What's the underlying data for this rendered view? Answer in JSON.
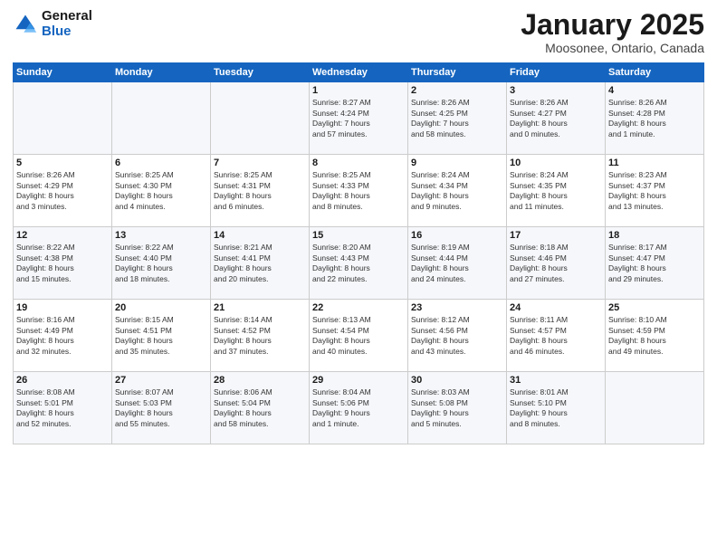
{
  "logo": {
    "line1": "General",
    "line2": "Blue"
  },
  "title": "January 2025",
  "location": "Moosonee, Ontario, Canada",
  "days_of_week": [
    "Sunday",
    "Monday",
    "Tuesday",
    "Wednesday",
    "Thursday",
    "Friday",
    "Saturday"
  ],
  "weeks": [
    [
      {
        "num": "",
        "info": ""
      },
      {
        "num": "",
        "info": ""
      },
      {
        "num": "",
        "info": ""
      },
      {
        "num": "1",
        "info": "Sunrise: 8:27 AM\nSunset: 4:24 PM\nDaylight: 7 hours\nand 57 minutes."
      },
      {
        "num": "2",
        "info": "Sunrise: 8:26 AM\nSunset: 4:25 PM\nDaylight: 7 hours\nand 58 minutes."
      },
      {
        "num": "3",
        "info": "Sunrise: 8:26 AM\nSunset: 4:27 PM\nDaylight: 8 hours\nand 0 minutes."
      },
      {
        "num": "4",
        "info": "Sunrise: 8:26 AM\nSunset: 4:28 PM\nDaylight: 8 hours\nand 1 minute."
      }
    ],
    [
      {
        "num": "5",
        "info": "Sunrise: 8:26 AM\nSunset: 4:29 PM\nDaylight: 8 hours\nand 3 minutes."
      },
      {
        "num": "6",
        "info": "Sunrise: 8:25 AM\nSunset: 4:30 PM\nDaylight: 8 hours\nand 4 minutes."
      },
      {
        "num": "7",
        "info": "Sunrise: 8:25 AM\nSunset: 4:31 PM\nDaylight: 8 hours\nand 6 minutes."
      },
      {
        "num": "8",
        "info": "Sunrise: 8:25 AM\nSunset: 4:33 PM\nDaylight: 8 hours\nand 8 minutes."
      },
      {
        "num": "9",
        "info": "Sunrise: 8:24 AM\nSunset: 4:34 PM\nDaylight: 8 hours\nand 9 minutes."
      },
      {
        "num": "10",
        "info": "Sunrise: 8:24 AM\nSunset: 4:35 PM\nDaylight: 8 hours\nand 11 minutes."
      },
      {
        "num": "11",
        "info": "Sunrise: 8:23 AM\nSunset: 4:37 PM\nDaylight: 8 hours\nand 13 minutes."
      }
    ],
    [
      {
        "num": "12",
        "info": "Sunrise: 8:22 AM\nSunset: 4:38 PM\nDaylight: 8 hours\nand 15 minutes."
      },
      {
        "num": "13",
        "info": "Sunrise: 8:22 AM\nSunset: 4:40 PM\nDaylight: 8 hours\nand 18 minutes."
      },
      {
        "num": "14",
        "info": "Sunrise: 8:21 AM\nSunset: 4:41 PM\nDaylight: 8 hours\nand 20 minutes."
      },
      {
        "num": "15",
        "info": "Sunrise: 8:20 AM\nSunset: 4:43 PM\nDaylight: 8 hours\nand 22 minutes."
      },
      {
        "num": "16",
        "info": "Sunrise: 8:19 AM\nSunset: 4:44 PM\nDaylight: 8 hours\nand 24 minutes."
      },
      {
        "num": "17",
        "info": "Sunrise: 8:18 AM\nSunset: 4:46 PM\nDaylight: 8 hours\nand 27 minutes."
      },
      {
        "num": "18",
        "info": "Sunrise: 8:17 AM\nSunset: 4:47 PM\nDaylight: 8 hours\nand 29 minutes."
      }
    ],
    [
      {
        "num": "19",
        "info": "Sunrise: 8:16 AM\nSunset: 4:49 PM\nDaylight: 8 hours\nand 32 minutes."
      },
      {
        "num": "20",
        "info": "Sunrise: 8:15 AM\nSunset: 4:51 PM\nDaylight: 8 hours\nand 35 minutes."
      },
      {
        "num": "21",
        "info": "Sunrise: 8:14 AM\nSunset: 4:52 PM\nDaylight: 8 hours\nand 37 minutes."
      },
      {
        "num": "22",
        "info": "Sunrise: 8:13 AM\nSunset: 4:54 PM\nDaylight: 8 hours\nand 40 minutes."
      },
      {
        "num": "23",
        "info": "Sunrise: 8:12 AM\nSunset: 4:56 PM\nDaylight: 8 hours\nand 43 minutes."
      },
      {
        "num": "24",
        "info": "Sunrise: 8:11 AM\nSunset: 4:57 PM\nDaylight: 8 hours\nand 46 minutes."
      },
      {
        "num": "25",
        "info": "Sunrise: 8:10 AM\nSunset: 4:59 PM\nDaylight: 8 hours\nand 49 minutes."
      }
    ],
    [
      {
        "num": "26",
        "info": "Sunrise: 8:08 AM\nSunset: 5:01 PM\nDaylight: 8 hours\nand 52 minutes."
      },
      {
        "num": "27",
        "info": "Sunrise: 8:07 AM\nSunset: 5:03 PM\nDaylight: 8 hours\nand 55 minutes."
      },
      {
        "num": "28",
        "info": "Sunrise: 8:06 AM\nSunset: 5:04 PM\nDaylight: 8 hours\nand 58 minutes."
      },
      {
        "num": "29",
        "info": "Sunrise: 8:04 AM\nSunset: 5:06 PM\nDaylight: 9 hours\nand 1 minute."
      },
      {
        "num": "30",
        "info": "Sunrise: 8:03 AM\nSunset: 5:08 PM\nDaylight: 9 hours\nand 5 minutes."
      },
      {
        "num": "31",
        "info": "Sunrise: 8:01 AM\nSunset: 5:10 PM\nDaylight: 9 hours\nand 8 minutes."
      },
      {
        "num": "",
        "info": ""
      }
    ]
  ]
}
